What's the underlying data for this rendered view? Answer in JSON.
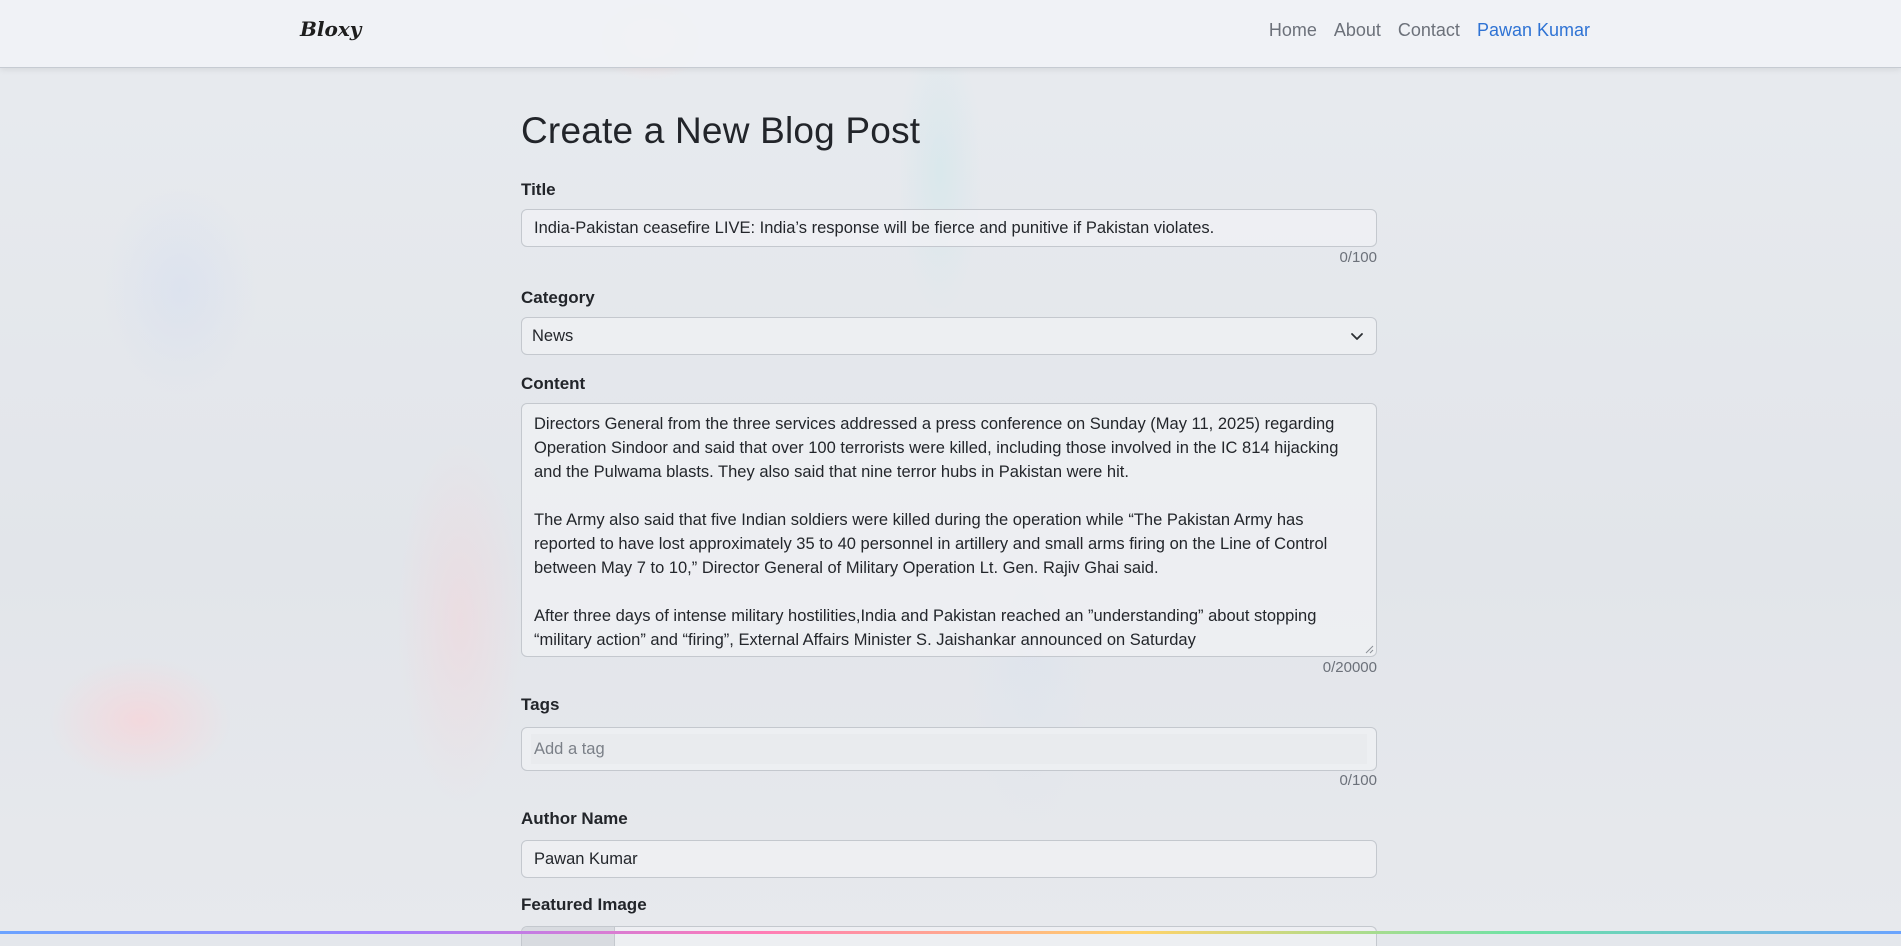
{
  "navbar": {
    "brand": "Bloxy",
    "links": [
      "Home",
      "About",
      "Contact"
    ],
    "user": "Pawan Kumar"
  },
  "page": {
    "heading": "Create a New Blog Post"
  },
  "form": {
    "title": {
      "label": "Title",
      "value": "India-Pakistan ceasefire LIVE: India’s response will be fierce and punitive if Pakistan violates.",
      "counter": "0/100"
    },
    "category": {
      "label": "Category",
      "value": "News"
    },
    "content": {
      "label": "Content",
      "paragraphs": [
        "Directors General from the three services addressed a press conference on Sunday (May 11, 2025) regarding Operation Sindoor and said that over 100 terrorists were killed, including those involved in the IC 814 hijacking and the Pulwama blasts. They also said that nine terror hubs in Pakistan were hit.",
        "The Army also said that five Indian soldiers were killed during the operation while “The Pakistan Army has reported to have lost approximately 35 to 40 personnel in artillery and small arms firing on the Line of Control between May 7 to 10,” Director General of Military Operation Lt. Gen. Rajiv Ghai said.",
        "After three days of intense military hostilities,India and Pakistan reached an ”understanding” about stopping “military action” and “firing”, External Affairs Minister S. Jaishankar announced on Saturday"
      ],
      "counter": "0/20000"
    },
    "tags": {
      "label": "Tags",
      "placeholder": "Add a tag",
      "counter": "0/100"
    },
    "author": {
      "label": "Author Name",
      "value": "Pawan Kumar"
    },
    "featured_image": {
      "label": "Featured Image"
    }
  },
  "icons": {
    "select_arrow": "chevron-down-icon",
    "resize": "resize-handle-icon"
  }
}
